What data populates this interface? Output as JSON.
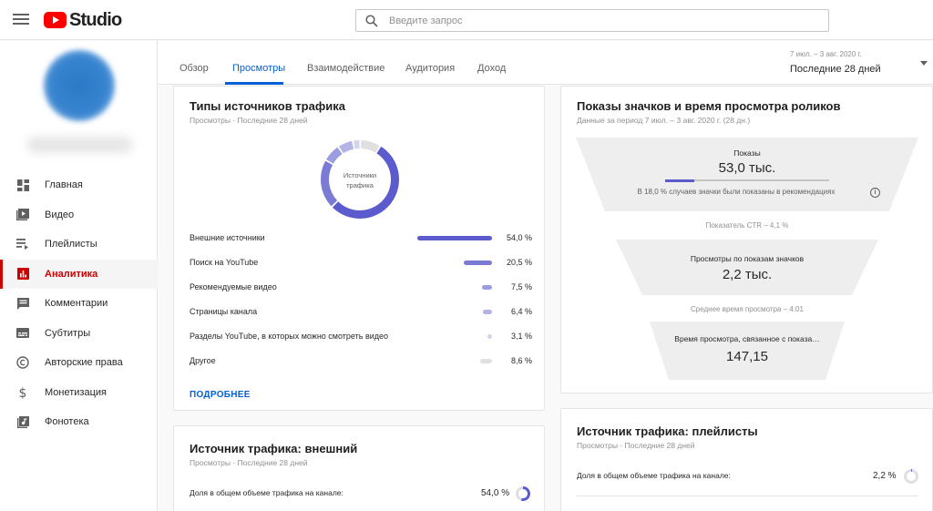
{
  "header": {
    "logo_text": "Studio",
    "search_placeholder": "Введите запрос"
  },
  "sidebar": {
    "items": [
      {
        "label": "Главная",
        "icon": "dashboard-icon"
      },
      {
        "label": "Видео",
        "icon": "video-icon"
      },
      {
        "label": "Плейлисты",
        "icon": "playlist-icon"
      },
      {
        "label": "Аналитика",
        "icon": "analytics-icon",
        "active": true
      },
      {
        "label": "Комментарии",
        "icon": "comments-icon"
      },
      {
        "label": "Субтитры",
        "icon": "subtitles-icon"
      },
      {
        "label": "Авторские права",
        "icon": "copyright-icon"
      },
      {
        "label": "Монетизация",
        "icon": "dollar-icon"
      },
      {
        "label": "Фонотека",
        "icon": "audio-library-icon"
      }
    ]
  },
  "tabs": {
    "items": [
      "Обзор",
      "Просмотры",
      "Взаимодействие",
      "Аудитория",
      "Доход"
    ],
    "active": "Просмотры"
  },
  "date": {
    "range": "7 июл. – 3 авг. 2020 г.",
    "label": "Последние 28 дней"
  },
  "traffic_types": {
    "title": "Типы источников трафика",
    "subtitle": "Просмотры · Последние 28 дней",
    "donut_label_line1": "Источники",
    "donut_label_line2": "трафика",
    "rows": [
      {
        "label": "Внешние источники",
        "pct": "54,0 %",
        "value": 54.0,
        "color": "#5b5bce"
      },
      {
        "label": "Поиск на YouTube",
        "pct": "20,5 %",
        "value": 20.5,
        "color": "#7b7bd6"
      },
      {
        "label": "Рекомендуемые видео",
        "pct": "7,5 %",
        "value": 7.5,
        "color": "#9c9ce0"
      },
      {
        "label": "Страницы канала",
        "pct": "6,4 %",
        "value": 6.4,
        "color": "#b3b3e6"
      },
      {
        "label": "Разделы YouTube, в которых можно смотреть видео",
        "pct": "3,1 %",
        "value": 3.1,
        "color": "#d3d3ee"
      },
      {
        "label": "Другое",
        "pct": "8,6 %",
        "value": 8.6,
        "color": "#e0e0e0"
      }
    ],
    "more_label": "ПОДРОБНЕЕ"
  },
  "impressions": {
    "title": "Показы значков и время просмотра роликов",
    "subtitle": "Данные за период 7 июл. – 3 авг. 2020 г. (28 дн.)",
    "impressions_label": "Показы",
    "impressions_value": "53,0 тыс.",
    "recommend_share": 18.0,
    "recommend_note": "В 18,0 % случаев значки были показаны в рекомендациях",
    "ctr_label": "Показатель CTR – 4,1 %",
    "views_label": "Просмотры по показам значков",
    "views_value": "2,2 тыс.",
    "avg_view_label": "Среднее время просмотра – 4:01",
    "watch_time_label": "Время просмотра, связанное с показа…",
    "watch_time_value": "147,15"
  },
  "traffic_external": {
    "title": "Источник трафика: внешний",
    "subtitle": "Просмотры · Последние 28 дней",
    "share_label": "Доля в общем объеме трафика на канале:",
    "share_value": "54,0 %",
    "share_num": 54.0
  },
  "traffic_playlists": {
    "title": "Источник трафика: плейлисты",
    "subtitle": "Просмотры · Последние 28 дней",
    "share_label": "Доля в общем объеме трафика на канале:",
    "share_value": "2,2 %",
    "share_num": 2.2
  },
  "colors": {
    "accent": "#065fd4",
    "active_nav": "#cc0000",
    "series": "#5b5bce"
  }
}
